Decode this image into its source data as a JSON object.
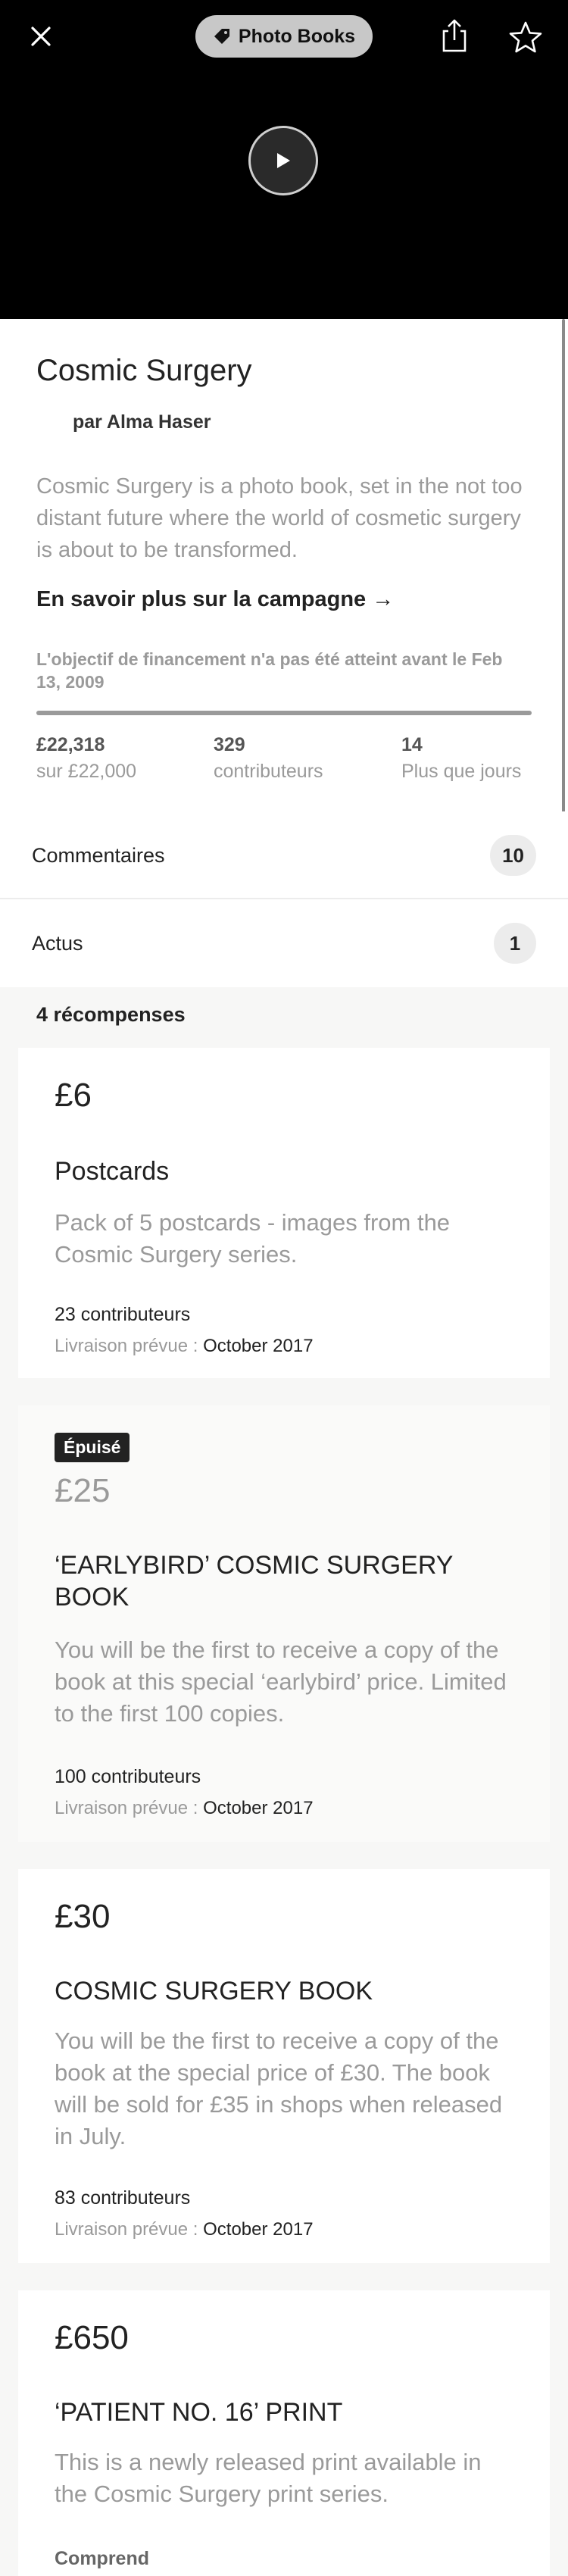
{
  "header": {
    "category": "Photo Books",
    "icons": {
      "close": "close-icon",
      "tag": "tag-icon",
      "share": "share-icon",
      "star": "star-icon",
      "play": "play-icon"
    }
  },
  "project": {
    "title": "Cosmic Surgery",
    "byline": "par Alma Haser",
    "blurb": "Cosmic Surgery is a photo book, set in the not too distant future where the world of cosmetic surgery is about to be transformed.",
    "learn_more": "En savoir plus sur la campagne →",
    "funding_note": "L'objectif de financement n'a pas été atteint avant le Feb 13, 2009",
    "progress_fraction": 1.0,
    "stats": {
      "pledged": "£22,318",
      "goal": "sur £22,000",
      "backers": "329",
      "backers_label": "contributeurs",
      "days": "14",
      "days_label": "Plus que jours"
    }
  },
  "rows": {
    "comments_label": "Commentaires",
    "comments_count": "10",
    "updates_label": "Actus",
    "updates_count": "1"
  },
  "rewards_heading": "4 récompenses",
  "delivery_label": "Livraison prévue :",
  "rewards": [
    {
      "price": "£6",
      "title": "Postcards",
      "description": "Pack of 5 postcards - images from the Cosmic Surgery series.",
      "backers": "23 contributeurs",
      "delivery": "October 2017"
    },
    {
      "badge": "Épuisé",
      "price": "£25",
      "title": "‘EARLYBIRD’ COSMIC SURGERY BOOK",
      "description": "You will be the first to receive a copy of the book at this special ‘earlybird’ price. Limited to the first 100 copies.",
      "backers": "100 contributeurs",
      "delivery": "October 2017"
    },
    {
      "price": "£30",
      "title": "COSMIC SURGERY BOOK",
      "description": "You will be the first to receive a copy of the book at the special price of £30. The book will be sold for £35 in shops when released in July.",
      "backers": "83 contributeurs",
      "delivery": "October 2017"
    },
    {
      "price": "£650",
      "title": "‘PATIENT NO. 16’ PRINT",
      "description": "This is a newly released print available in the Cosmic Surgery print series.",
      "includes_label": "Comprend"
    }
  ]
}
